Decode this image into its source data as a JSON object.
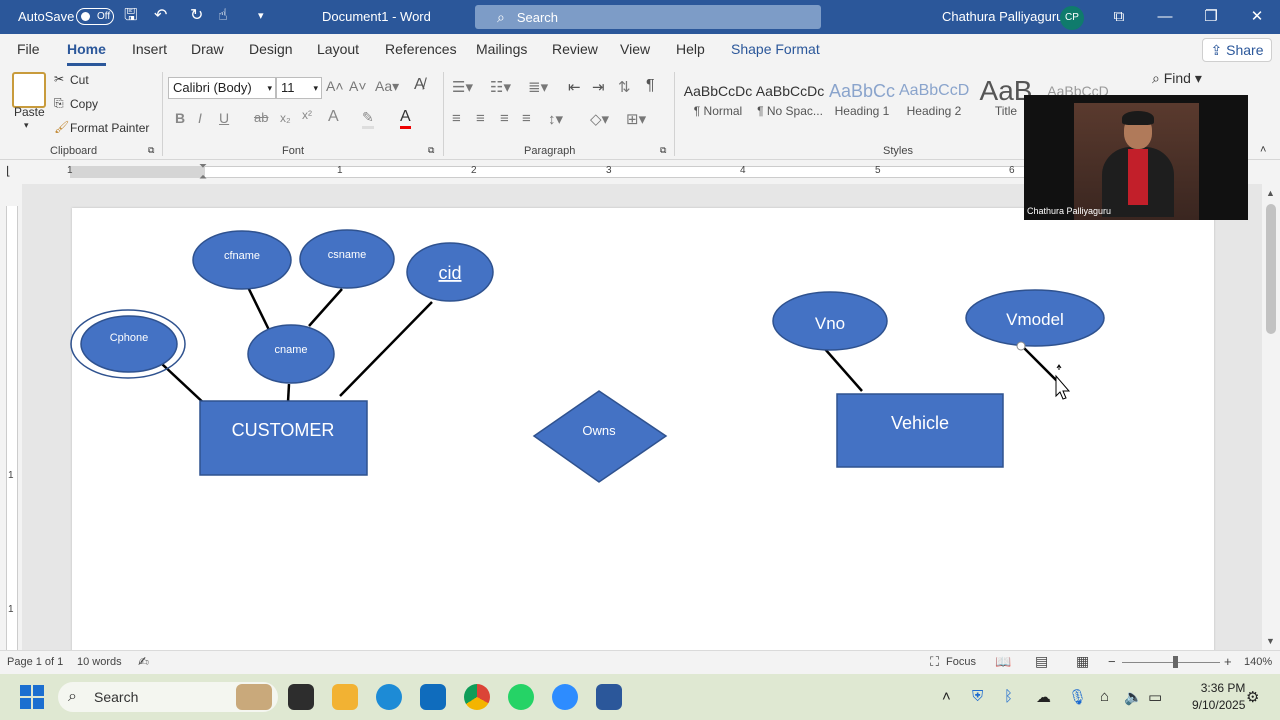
{
  "titlebar": {
    "autosave": "AutoSave",
    "autosave_state": "Off",
    "doc_title": "Document1  -  Word",
    "search_placeholder": "Search",
    "user_name": "Chathura Palliyaguru",
    "user_initials": "CP"
  },
  "tabs": [
    "File",
    "Home",
    "Insert",
    "Draw",
    "Design",
    "Layout",
    "References",
    "Mailings",
    "Review",
    "View",
    "Help",
    "Shape Format"
  ],
  "share_label": "Share",
  "ribbon": {
    "clipboard": {
      "paste": "Paste",
      "cut": "Cut",
      "copy": "Copy",
      "format_painter": "Format Painter",
      "label": "Clipboard"
    },
    "font": {
      "name": "Calibri (Body)",
      "size": "11",
      "label": "Font"
    },
    "paragraph": {
      "label": "Paragraph"
    },
    "styles": {
      "label": "Styles",
      "items": [
        {
          "sample": "AaBbCcDc",
          "name": "¶ Normal"
        },
        {
          "sample": "AaBbCcDc",
          "name": "¶ No Spac..."
        },
        {
          "sample": "AaBbCc",
          "name": "Heading 1"
        },
        {
          "sample": "AaBbCcD",
          "name": "Heading 2"
        },
        {
          "sample": "AaB",
          "name": "Title"
        },
        {
          "sample": "AaBbCcD",
          "name": ""
        }
      ]
    },
    "find": "Find"
  },
  "ruler": [
    "1",
    "1",
    "2",
    "3",
    "4",
    "5",
    "6"
  ],
  "diagram": {
    "attributes": {
      "cfname": "cfname",
      "csname": "csname",
      "cid": "cid",
      "cphone": "Cphone",
      "cname": "cname",
      "vno": "Vno",
      "vmodel": "Vmodel"
    },
    "entities": {
      "customer": "CUSTOMER",
      "vehicle": "Vehicle"
    },
    "relationship": "Owns",
    "colors": {
      "fill": "#4472c4",
      "outline": "#2f528f"
    }
  },
  "video": {
    "name": "Chathura Palliyaguru"
  },
  "status": {
    "page": "Page 1 of 1",
    "words": "10 words",
    "focus": "Focus",
    "zoom": "140%"
  },
  "taskbar": {
    "search": "Search",
    "time": "3:36 PM",
    "date": "9/10/2025"
  }
}
